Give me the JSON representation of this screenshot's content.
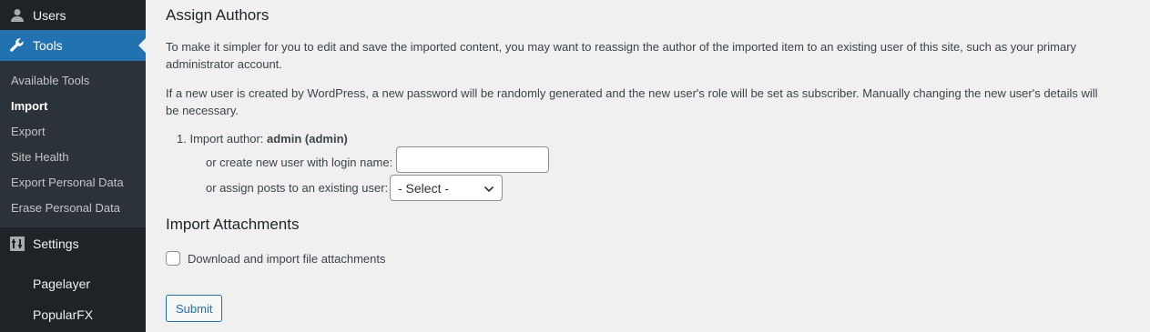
{
  "sidebar": {
    "users_label": "Users",
    "tools_label": "Tools",
    "tools_submenu": [
      {
        "label": "Available Tools",
        "current": false
      },
      {
        "label": "Import",
        "current": true
      },
      {
        "label": "Export",
        "current": false
      },
      {
        "label": "Site Health",
        "current": false
      },
      {
        "label": "Export Personal Data",
        "current": false
      },
      {
        "label": "Erase Personal Data",
        "current": false
      }
    ],
    "settings_label": "Settings",
    "pagelayer_label": "Pagelayer",
    "popularfx_label": "PopularFX",
    "accent_color": "#2271b1",
    "icons": {
      "users": "user-icon",
      "tools": "wrench-icon",
      "settings": "settings-icon"
    }
  },
  "main": {
    "assign_authors_heading": "Assign Authors",
    "desc1": "To make it simpler for you to edit and save the imported content, you may want to reassign the author of the imported item to an existing user of this site, such as your primary administrator account.",
    "desc2": "If a new user is created by WordPress, a new password will be randomly generated and the new user's role will be set as subscriber. Manually changing the new user's details will be necessary.",
    "author_prefix": "1. Import author: ",
    "author_name": "admin (admin)",
    "new_user_label": "or create new user with login name:",
    "new_user_value": "",
    "existing_user_label": "or assign posts to an existing user:",
    "existing_user_selected": "- Select -",
    "attachments_heading": "Import Attachments",
    "attachments_checkbox_label": "Download and import file attachments",
    "attachments_checked": false,
    "submit_label": "Submit"
  }
}
